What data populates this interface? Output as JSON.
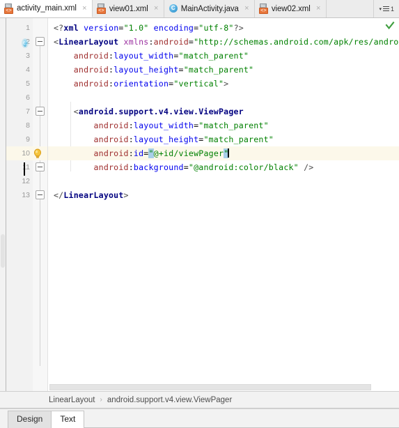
{
  "tabs": [
    {
      "label": "activity_main.xml",
      "icon": "android-xml-file-icon",
      "active": true,
      "close": "×"
    },
    {
      "label": "view01.xml",
      "icon": "android-xml-file-icon",
      "active": false,
      "close": "×"
    },
    {
      "label": "MainActivity.java",
      "icon": "java-class-file-icon",
      "active": false,
      "close": "×",
      "badge": "C"
    },
    {
      "label": "view02.xml",
      "icon": "android-xml-file-icon",
      "active": false,
      "close": "×"
    }
  ],
  "tab_overflow": {
    "caret": "▾",
    "icon": "tab-list-icon",
    "count": "1"
  },
  "editor": {
    "inspection_status": "ok",
    "xml_tag_char": "<>",
    "line_numbers": [
      "1",
      "2",
      "3",
      "4",
      "5",
      "6",
      "7",
      "8",
      "9",
      "10",
      "11",
      "12",
      "13"
    ],
    "highlighted_line": 10,
    "gutter_icons": {
      "line2": "class-marker-icon",
      "line2_letter": "C",
      "line10": "intention-bulb-icon",
      "line11": "color-swatch-black-icon"
    },
    "lines": [
      {
        "n": 1,
        "text": "<?xml version=\"1.0\" encoding=\"utf-8\"?>"
      },
      {
        "n": 2,
        "text": "<LinearLayout xmlns:android=\"http://schemas.android.com/apk/res/android\""
      },
      {
        "n": 3,
        "text": "    android:layout_width=\"match_parent\""
      },
      {
        "n": 4,
        "text": "    android:layout_height=\"match_parent\""
      },
      {
        "n": 5,
        "text": "    android:orientation=\"vertical\">"
      },
      {
        "n": 6,
        "text": ""
      },
      {
        "n": 7,
        "text": "    <android.support.v4.view.ViewPager"
      },
      {
        "n": 8,
        "text": "        android:layout_width=\"match_parent\""
      },
      {
        "n": 9,
        "text": "        android:layout_height=\"match_parent\""
      },
      {
        "n": 10,
        "text": "        android:id=\"@+id/viewPager\""
      },
      {
        "n": 11,
        "text": "        android:background=\"@android:color/black\" />"
      },
      {
        "n": 12,
        "text": ""
      },
      {
        "n": 13,
        "text": "</LinearLayout>"
      }
    ]
  },
  "breadcrumb": {
    "root": "LinearLayout",
    "separator": "›",
    "leaf": "android.support.v4.view.ViewPager"
  },
  "bottom_tabs": [
    {
      "label": "Design",
      "active": false
    },
    {
      "label": "Text",
      "active": true
    }
  ],
  "colors": {
    "tag": "#000080",
    "namespace": "#9b30a0",
    "prefix": "#9e2d2d",
    "attribute": "#0000ee",
    "value": "#008000",
    "punct": "#4a4a4a",
    "highlight_line": "#fcf8ea",
    "bracket_match": "#a8cfe8",
    "tab_accent": "#e8763a",
    "inspection_ok": "#3f9e3f"
  }
}
